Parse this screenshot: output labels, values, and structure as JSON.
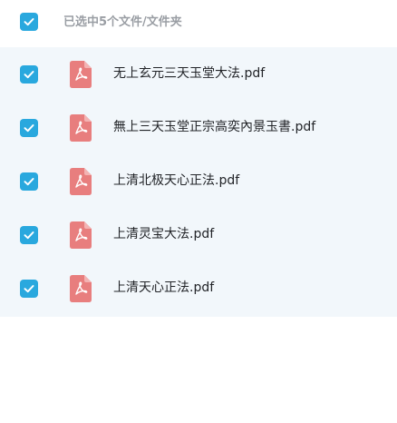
{
  "header": {
    "title": "已选中5个文件/文件夹",
    "checked": true
  },
  "files": [
    {
      "name": "无上玄元三天玉堂大法.pdf",
      "checked": true,
      "icon": "pdf-file-icon"
    },
    {
      "name": "無上三天玉堂正宗高奕內景玉書.pdf",
      "checked": true,
      "icon": "pdf-file-icon"
    },
    {
      "name": "上清北极天心正法.pdf",
      "checked": true,
      "icon": "pdf-file-icon"
    },
    {
      "name": "上清灵宝大法.pdf",
      "checked": true,
      "icon": "pdf-file-icon"
    },
    {
      "name": "上清天心正法.pdf",
      "checked": true,
      "icon": "pdf-file-icon"
    }
  ],
  "colors": {
    "accent": "#29a8de",
    "list_background": "#f2f7fb",
    "pdf_icon": "#e87e7e",
    "header_text": "#9a9ea4"
  }
}
